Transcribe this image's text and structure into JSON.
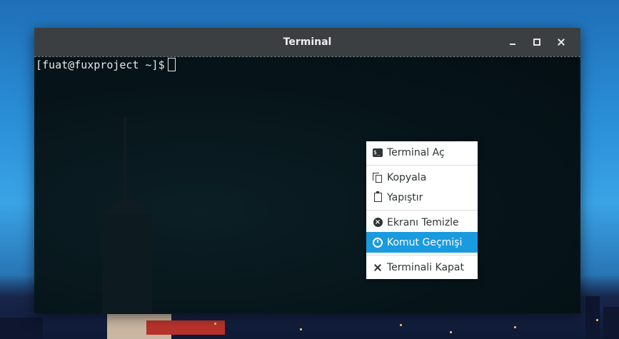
{
  "window": {
    "title": "Terminal",
    "controls": [
      "minimize-icon",
      "maximize-icon",
      "close-icon"
    ]
  },
  "terminal": {
    "prompt": "[fuat@fuxproject ~]$"
  },
  "context_menu": {
    "items": [
      {
        "label": "Terminal Aç",
        "icon": "terminal-icon"
      },
      {
        "label": "Kopyala",
        "icon": "copy-icon"
      },
      {
        "label": "Yapıştır",
        "icon": "paste-icon"
      },
      {
        "label": "Ekranı Temizle",
        "icon": "clear-screen-icon"
      },
      {
        "label": "Komut Geçmişi",
        "icon": "history-icon",
        "highlighted": true
      },
      {
        "label": "Terminali Kapat",
        "icon": "close-terminal-icon"
      }
    ],
    "highlight_color": "#1a9be0"
  },
  "colors": {
    "titlebar": "#3b3f42",
    "terminal_bg": "#051217",
    "menu_bg": "#ffffff"
  }
}
